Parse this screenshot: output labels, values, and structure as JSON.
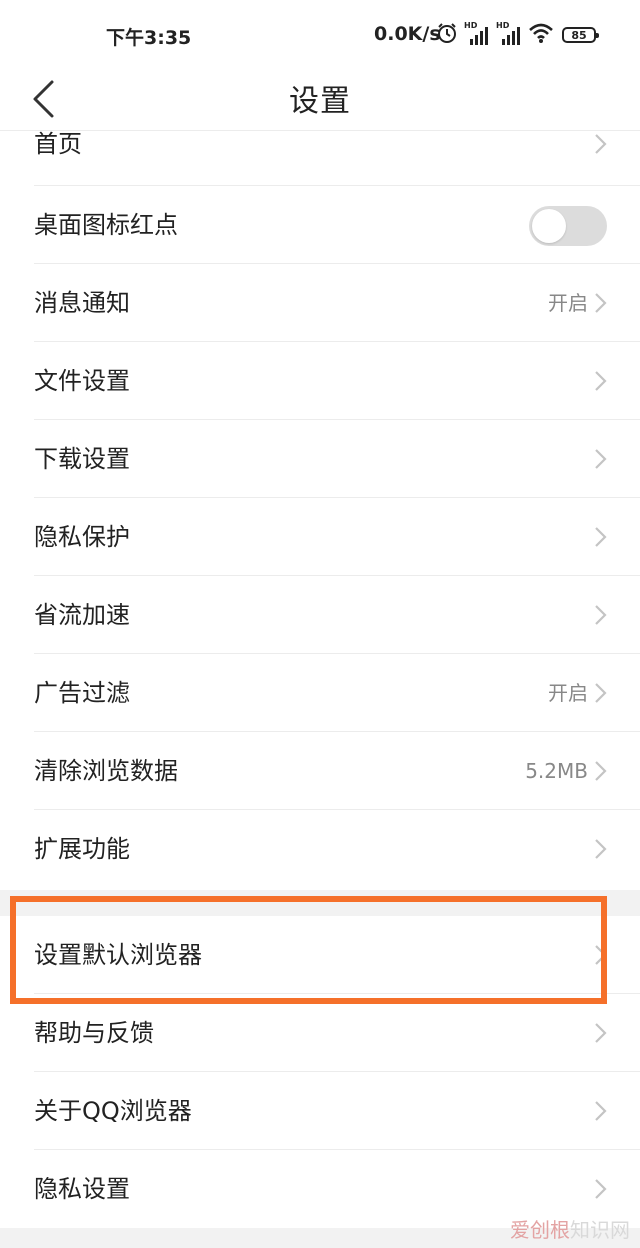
{
  "status_bar": {
    "time": "下午3:35",
    "speed": "0.0K/s",
    "icons": [
      "alarm-icon",
      "hd-signal-icon",
      "hd-signal-icon",
      "wifi-icon",
      "battery-icon"
    ],
    "hd_label": "HD",
    "battery": "85"
  },
  "header": {
    "back_icon": "chevron-left-icon",
    "title": "设置"
  },
  "settings": {
    "items": [
      {
        "label": "首页"
      },
      {
        "label": "桌面图标红点",
        "toggle": "off"
      },
      {
        "label": "消息通知",
        "value": "开启"
      },
      {
        "label": "文件设置"
      },
      {
        "label": "下载设置"
      },
      {
        "label": "隐私保护"
      },
      {
        "label": "省流加速"
      },
      {
        "label": "广告过滤",
        "value": "开启"
      },
      {
        "label": "清除浏览数据",
        "value": "5.2MB"
      },
      {
        "label": "扩展功能"
      }
    ],
    "items2": [
      {
        "label": "设置默认浏览器"
      },
      {
        "label": "帮助与反馈"
      },
      {
        "label": "关于QQ浏览器"
      },
      {
        "label": "隐私设置"
      }
    ]
  },
  "annotation": {
    "highlight_color": "#f5702a"
  },
  "colors": {
    "toggle_off": "#dcdcdc",
    "divider": "#ececec",
    "section_bg": "#f2f2f2"
  },
  "watermark": {
    "logo": "爱创根",
    "text": "知识网"
  }
}
